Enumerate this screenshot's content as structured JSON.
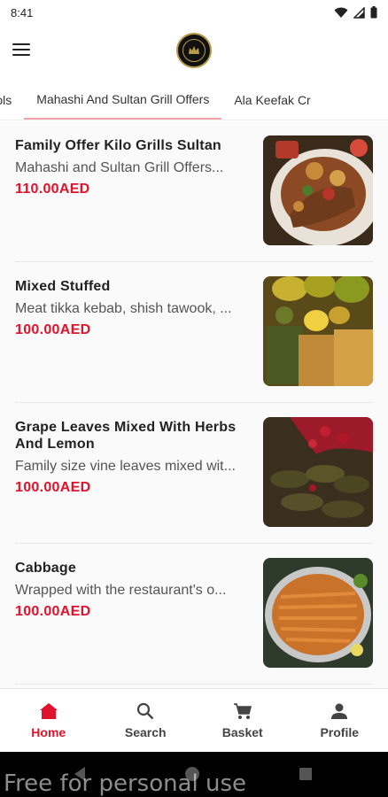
{
  "status_bar": {
    "time": "8:41"
  },
  "tabs": [
    {
      "label": "Offers for Universities and Schools",
      "active": false
    },
    {
      "label": "Mahashi And Sultan Grill Offers",
      "active": true
    },
    {
      "label": "Ala Keefak Cr",
      "active": false
    }
  ],
  "items": [
    {
      "title": "Family Offer Kilo Grills Sultan",
      "description": "Mahashi and Sultan Grill Offers...",
      "price": "110.00AED"
    },
    {
      "title": "Mixed Stuffed",
      "description": "Meat tikka kebab, shish tawook, ...",
      "price": "100.00AED"
    },
    {
      "title": "Grape Leaves Mixed With Herbs And Lemon",
      "description": "Family size vine leaves mixed wit...",
      "price": "100.00AED"
    },
    {
      "title": "Cabbage",
      "description": "Wrapped with the restaurant's o...",
      "price": "100.00AED"
    }
  ],
  "bottom_nav": [
    {
      "label": "Home",
      "icon": "home-icon",
      "active": true
    },
    {
      "label": "Search",
      "icon": "search-icon",
      "active": false
    },
    {
      "label": "Basket",
      "icon": "cart-icon",
      "active": false
    },
    {
      "label": "Profile",
      "icon": "person-icon",
      "active": false
    }
  ],
  "watermark": "Free for personal use",
  "colors": {
    "accent": "#e0132c",
    "tab_indicator": "#f2a3a3",
    "logo_gold": "#b89b4a"
  }
}
